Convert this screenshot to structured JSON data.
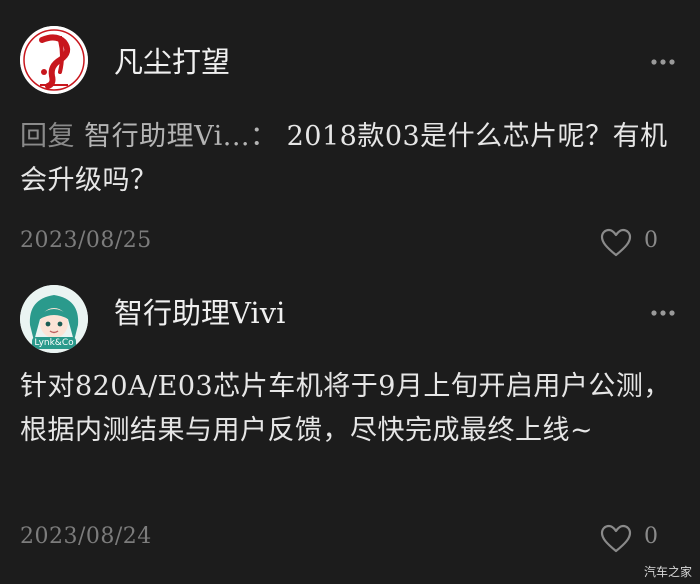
{
  "comments": [
    {
      "username": "凡尘打望",
      "reply_prefix": "回复",
      "reply_target": "智行助理Vi...：",
      "text": "2018款03是什么芯片呢？有机会升级吗？",
      "date": "2023/08/25",
      "like_count": "0",
      "avatar": "red-calligraphy-logo-avatar",
      "more_icon": "more-dots-icon",
      "like_icon": "heart-outline-icon"
    },
    {
      "username": "智行助理Vivi",
      "text": "针对820A/E03芯片车机将于9月上旬开启用户公测，根据内测结果与用户反馈，尽快完成最终上线~",
      "date": "2023/08/24",
      "like_count": "0",
      "avatar": "lynk-co-anime-avatar",
      "avatar_label": "Lynk&Co",
      "more_icon": "more-dots-icon",
      "like_icon": "heart-outline-icon"
    }
  ],
  "watermark": "汽车之家",
  "colors": {
    "background": "#1c1c1c",
    "text": "#e6e6e6",
    "muted": "#7c7c7c",
    "brand_red": "#c8161d",
    "avatar_teal": "#2a9a8c"
  }
}
